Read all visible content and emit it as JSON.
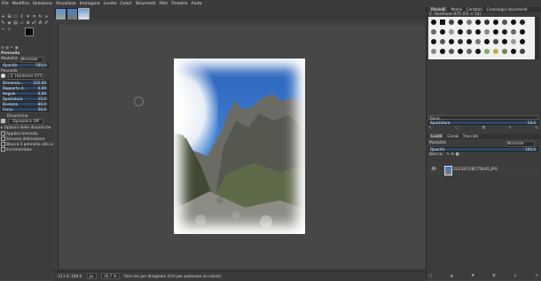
{
  "menu": [
    "File",
    "Modifica",
    "Seleziona",
    "Visualizza",
    "Immagine",
    "Livello",
    "Colori",
    "Strumenti",
    "Filtri",
    "Finestre",
    "Aiuto"
  ],
  "tool_options": {
    "title": "Pennello",
    "mode_label": "Modalità",
    "mode_value": "Normale",
    "opacity_label": "Opacità",
    "opacity_value": "100,0",
    "brush_label": "Pennello",
    "brush_value": "2. Hardness 075",
    "size_label": "Dimensio...",
    "size_value": "232,00",
    "ratio_label": "Rapporto d...",
    "ratio_value": "0,00",
    "angle_label": "Angolo",
    "angle_value": "0,00",
    "spacing_label": "Spaziatura",
    "spacing_value": "15,0",
    "hardness_label": "Durezza",
    "hardness_value": "80,0",
    "force_label": "Forza",
    "force_value": "50,0",
    "dynamics_label": "Dinamiche",
    "dynamics_value": "Dynamics Off",
    "dyn_options": "Opzioni delle dinamiche",
    "apply_jitter": "Applica tremolio",
    "smooth_stroke": "Smussa delineatore",
    "lock_brush": "Blocca il pennello alla vist",
    "incremental": "Incrementale"
  },
  "right_dock": {
    "tabs": [
      "Pennelli",
      "Motivi",
      "Caratteri",
      "Cronologia documenti"
    ],
    "brush_name": "2. Hardness 075 (51 × 51)",
    "filter_label": "Basic,",
    "spacing_label": "Spaziatura",
    "spacing_value": "10,0",
    "layer_tabs": [
      "Livelli",
      "Canali",
      "Tracciati"
    ],
    "mode_label": "Modalità",
    "mode_value": "Normale",
    "opacity_label": "Opacità",
    "opacity_value": "100,0",
    "lock_label": "Blocca:",
    "layer_name": "20230728175645.JPG"
  },
  "status": {
    "coords": "-111.0, 100.0",
    "unit": "px",
    "zoom": "16,7 %",
    "hint": "Fare clic per disegnare (Ctrl per prelevare un colore)"
  }
}
